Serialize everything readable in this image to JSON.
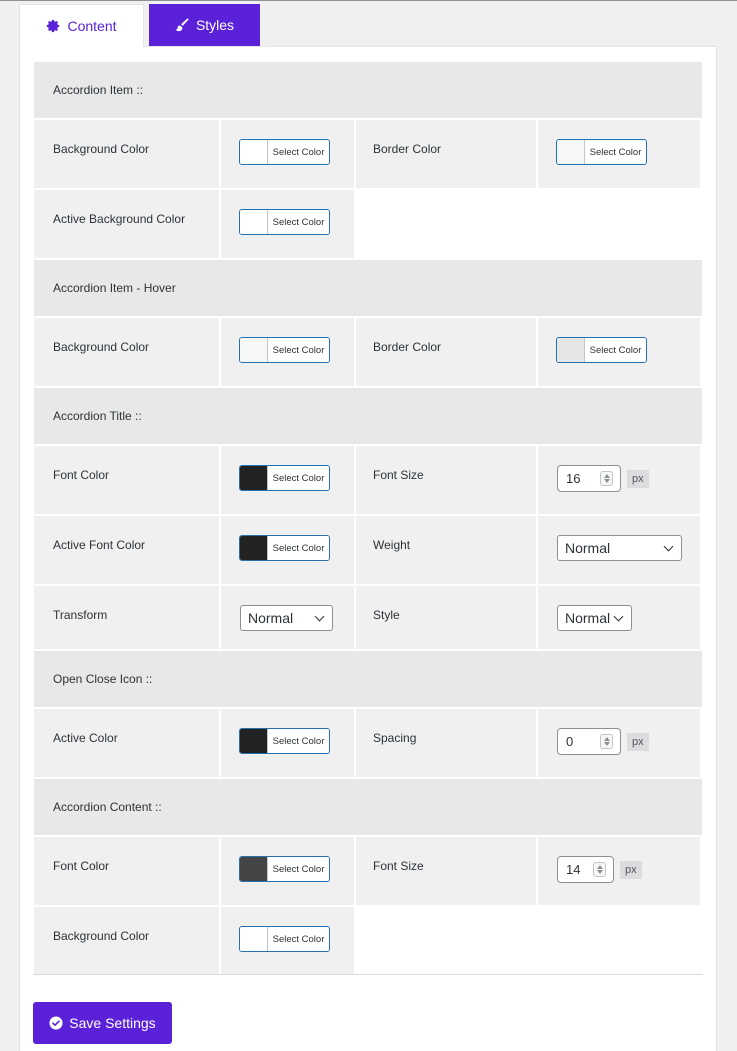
{
  "tabs": {
    "content": "Content",
    "styles": "Styles"
  },
  "accent_color": "#5b21d9",
  "picker_label": "Select Color",
  "sections": {
    "item": {
      "title": "Accordion Item ::",
      "background_color": {
        "label": "Background Color",
        "swatch": "#ffffff"
      },
      "border_color": {
        "label": "Border Color",
        "swatch": "#f6f7f7"
      },
      "active_background_color": {
        "label": "Active Background Color",
        "swatch": "#ffffff"
      }
    },
    "item_hover": {
      "title": "Accordion Item - Hover",
      "background_color": {
        "label": "Background Color",
        "swatch": "#f6f7f7"
      },
      "border_color": {
        "label": "Border Color",
        "swatch": "#e6e6e6"
      }
    },
    "title": {
      "title": "Accordion Title ::",
      "font_color": {
        "label": "Font Color",
        "swatch": "#222222"
      },
      "font_size": {
        "label": "Font Size",
        "value": "16",
        "unit": "px"
      },
      "active_font_color": {
        "label": "Active Font Color",
        "swatch": "#222222"
      },
      "weight": {
        "label": "Weight",
        "value": "Normal"
      },
      "transform": {
        "label": "Transform",
        "value": "Normal"
      },
      "style": {
        "label": "Style",
        "value": "Normal"
      }
    },
    "icon": {
      "title": "Open Close Icon ::",
      "active_color": {
        "label": "Active Color",
        "swatch": "#222222"
      },
      "spacing": {
        "label": "Spacing",
        "value": "0",
        "unit": "px"
      }
    },
    "content": {
      "title": "Accordion Content ::",
      "font_color": {
        "label": "Font Color",
        "swatch": "#444444"
      },
      "font_size": {
        "label": "Font Size",
        "value": "14",
        "unit": "px"
      },
      "background_color": {
        "label": "Background Color",
        "swatch": "#ffffff"
      }
    }
  },
  "save_label": "Save Settings"
}
